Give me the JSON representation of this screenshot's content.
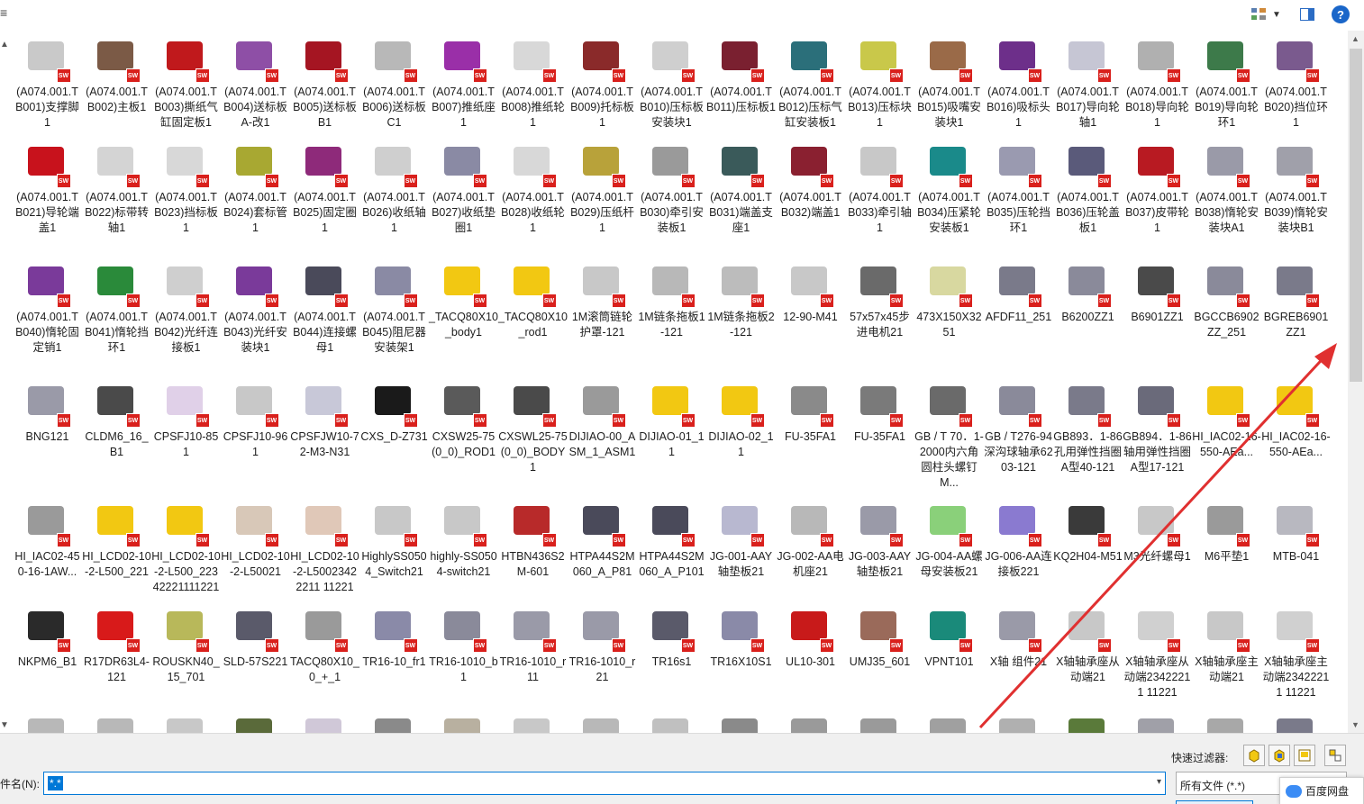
{
  "toolbar": {
    "left_glyph": "≡",
    "view_icon": "view-menu-icon",
    "dropdown_glyph": "▼",
    "preview_icon": "preview-pane-icon",
    "help_label": "?"
  },
  "files": [
    {
      "name": "(A074.001.TB001)支撑脚1",
      "color": "#c9c9c9"
    },
    {
      "name": "(A074.001.TB002)主板1",
      "color": "#7b5a46"
    },
    {
      "name": "(A074.001.TB003)撕纸气缸固定板1",
      "color": "#c0191c"
    },
    {
      "name": "(A074.001.TB004)送标板A-改1",
      "color": "#8e4fa6"
    },
    {
      "name": "(A074.001.TB005)送标板B1",
      "color": "#a51522"
    },
    {
      "name": "(A074.001.TB006)送标板C1",
      "color": "#b8b8b8"
    },
    {
      "name": "(A074.001.TB007)推纸座1",
      "color": "#9a2fa8"
    },
    {
      "name": "(A074.001.TB008)推纸轮1",
      "color": "#d8d8d8"
    },
    {
      "name": "(A074.001.TB009)托标板1",
      "color": "#8a2a2a"
    },
    {
      "name": "(A074.001.TB010)压标板安装块1",
      "color": "#cfcfcf"
    },
    {
      "name": "(A074.001.TB011)压标板1",
      "color": "#7a2030"
    },
    {
      "name": "(A074.001.TB012)压标气缸安装板1",
      "color": "#2b6f7a"
    },
    {
      "name": "(A074.001.TB013)压标块1",
      "color": "#c9c84a"
    },
    {
      "name": "(A074.001.TB015)吸嘴安装块1",
      "color": "#9a6a48"
    },
    {
      "name": "(A074.001.TB016)吸标头1",
      "color": "#6d2f8a"
    },
    {
      "name": "(A074.001.TB017)导向轮轴1",
      "color": "#c6c6d4"
    },
    {
      "name": "(A074.001.TB018)导向轮1",
      "color": "#b0b0b0"
    },
    {
      "name": "(A074.001.TB019)导向轮环1",
      "color": "#3d7a4a"
    },
    {
      "name": "(A074.001.TB020)挡位环1",
      "color": "#7a5a8e"
    },
    {
      "name": "(A074.001.TB021)导轮端盖1",
      "color": "#c8121c"
    },
    {
      "name": "(A074.001.TB022)标带转轴1",
      "color": "#d4d4d4"
    },
    {
      "name": "(A074.001.TB023)挡标板1",
      "color": "#d8d8d8"
    },
    {
      "name": "(A074.001.TB024)套标管1",
      "color": "#a8a832"
    },
    {
      "name": "(A074.001.TB025)固定圈1",
      "color": "#8e2a7a"
    },
    {
      "name": "(A074.001.TB026)收纸轴1",
      "color": "#cfcfcf"
    },
    {
      "name": "(A074.001.TB027)收纸垫圈1",
      "color": "#8a8aa4"
    },
    {
      "name": "(A074.001.TB028)收纸轮1",
      "color": "#d8d8d8"
    },
    {
      "name": "(A074.001.TB029)压纸杆1",
      "color": "#b8a23a"
    },
    {
      "name": "(A074.001.TB030)牵引安装板1",
      "color": "#9a9a9a"
    },
    {
      "name": "(A074.001.TB031)端盖支座1",
      "color": "#3a5a5a"
    },
    {
      "name": "(A074.001.TB032)端盖1",
      "color": "#8a2030"
    },
    {
      "name": "(A074.001.TB033)牵引轴1",
      "color": "#c8c8c8"
    },
    {
      "name": "(A074.001.TB034)压紧轮安装板1",
      "color": "#1a8a8a"
    },
    {
      "name": "(A074.001.TB035)压轮挡环1",
      "color": "#9a9ab0"
    },
    {
      "name": "(A074.001.TB036)压轮盖板1",
      "color": "#5a5a7a"
    },
    {
      "name": "(A074.001.TB037)皮带轮1",
      "color": "#b81a22"
    },
    {
      "name": "(A074.001.TB038)惰轮安装块A1",
      "color": "#9a9aa8"
    },
    {
      "name": "(A074.001.TB039)惰轮安装块B1",
      "color": "#a0a0aa"
    },
    {
      "name": "(A074.001.TB040)惰轮固定销1",
      "color": "#7a3a9a"
    },
    {
      "name": "(A074.001.TB041)惰轮挡环1",
      "color": "#2a8a3a"
    },
    {
      "name": "(A074.001.TB042)光纤连接板1",
      "color": "#cfcfcf"
    },
    {
      "name": "(A074.001.TB043)光纤安装块1",
      "color": "#7a3a9a"
    },
    {
      "name": "(A074.001.TB044)连接螺母1",
      "color": "#4a4a5a"
    },
    {
      "name": "(A074.001.TB045)阻尼器安装架1",
      "color": "#8a8aa4"
    },
    {
      "name": "_TACQ80X10_body1",
      "color": "#f2c812"
    },
    {
      "name": "_TACQ80X10_rod1",
      "color": "#f2c812"
    },
    {
      "name": "1M滚筒链轮护罩-121",
      "color": "#c8c8c8"
    },
    {
      "name": "1M链条拖板1-121",
      "color": "#b8b8b8"
    },
    {
      "name": "1M链条拖板2-121",
      "color": "#bcbcbc"
    },
    {
      "name": "12-90-M41",
      "color": "#c8c8c8"
    },
    {
      "name": "57x57x45步进电机21",
      "color": "#6a6a6a"
    },
    {
      "name": "473X150X3251",
      "color": "#d8d8a0"
    },
    {
      "name": "AFDF11_251",
      "color": "#7a7a8a"
    },
    {
      "name": "B6200ZZ1",
      "color": "#8a8a9a"
    },
    {
      "name": "B6901ZZ1",
      "color": "#4a4a4a"
    },
    {
      "name": "BGCCB6902ZZ_251",
      "color": "#8a8a9a"
    },
    {
      "name": "BGREB6901ZZ1",
      "color": "#7a7a8a"
    },
    {
      "name": "BNG121",
      "color": "#9a9aa8"
    },
    {
      "name": "CLDM6_16_B1",
      "color": "#4a4a4a"
    },
    {
      "name": "CPSFJ10-851",
      "color": "#e0d0e8"
    },
    {
      "name": "CPSFJ10-961",
      "color": "#c8c8c8"
    },
    {
      "name": "CPSFJW10-72-M3-N31",
      "color": "#c8c8d8"
    },
    {
      "name": "CXS_D-Z731",
      "color": "#1a1a1a"
    },
    {
      "name": "CXSW25-75(0_0)_ROD1",
      "color": "#5a5a5a"
    },
    {
      "name": "CXSWL25-75(0_0)_BODY1",
      "color": "#4a4a4a"
    },
    {
      "name": "DIJIAO-00_ASM_1_ASM1",
      "color": "#9a9a9a"
    },
    {
      "name": "DIJIAO-01_11",
      "color": "#f2c812"
    },
    {
      "name": "DIJIAO-02_11",
      "color": "#f2c812"
    },
    {
      "name": "FU-35FA1",
      "color": "#8a8a8a"
    },
    {
      "name": "FU-35FA1",
      "color": "#7a7a7a"
    },
    {
      "name": "GB / T 70．1-2000内六角圆柱头螺钉M...",
      "color": "#6a6a6a"
    },
    {
      "name": "GB / T276-94深沟球轴承6203-121",
      "color": "#8a8a9a"
    },
    {
      "name": "GB893．1-86孔用弹性挡圈A型40-121",
      "color": "#7a7a8a"
    },
    {
      "name": "GB894．1-86轴用弹性挡圈A型17-121",
      "color": "#6a6a7a"
    },
    {
      "name": "HI_IAC02-16-550-AEa...",
      "color": "#f2c812"
    },
    {
      "name": "HI_IAC02-16-550-AEa...",
      "color": "#f2c812"
    },
    {
      "name": "HI_IAC02-450-16-1AW...",
      "color": "#9a9a9a"
    },
    {
      "name": "HI_LCD02-10-2-L500_221",
      "color": "#f2c812"
    },
    {
      "name": "HI_LCD02-10-2-L500_22342221111221",
      "color": "#f2c812"
    },
    {
      "name": "HI_LCD02-10-2-L50021",
      "color": "#d8c8b8"
    },
    {
      "name": "HI_LCD02-10-2-L50023422211 11221",
      "color": "#e0c8b8"
    },
    {
      "name": "HighlySS0504_Switch21",
      "color": "#c8c8c8"
    },
    {
      "name": "highly-SS0504-switch21",
      "color": "#c8c8c8"
    },
    {
      "name": "HTBN436S2M-601",
      "color": "#b82a2a"
    },
    {
      "name": "HTPA44S2M060_A_P81",
      "color": "#4a4a5a"
    },
    {
      "name": "HTPA44S2M060_A_P101",
      "color": "#4a4a5a"
    },
    {
      "name": "JG-001-AAY轴垫板21",
      "color": "#b8b8d0"
    },
    {
      "name": "JG-002-AA电机座21",
      "color": "#b8b8b8"
    },
    {
      "name": "JG-003-AAY轴垫板21",
      "color": "#9a9aa8"
    },
    {
      "name": "JG-004-AA螺母安装板21",
      "color": "#8ad07a"
    },
    {
      "name": "JG-006-AA连接板221",
      "color": "#8a7ad0"
    },
    {
      "name": "KQ2H04-M51",
      "color": "#3a3a3a"
    },
    {
      "name": "M3光纤螺母1",
      "color": "#c8c8c8"
    },
    {
      "name": "M6平垫1",
      "color": "#9a9a9a"
    },
    {
      "name": "MTB-041",
      "color": "#b8b8c0"
    },
    {
      "name": "NKPM6_B1",
      "color": "#2a2a2a"
    },
    {
      "name": "R17DR63L4-121",
      "color": "#d81a1a"
    },
    {
      "name": "ROUSKN40_15_701",
      "color": "#b8b85a"
    },
    {
      "name": "SLD-57S221",
      "color": "#5a5a6a"
    },
    {
      "name": "TACQ80X10_0_+_1",
      "color": "#9a9a9a"
    },
    {
      "name": "TR16-10_fr1",
      "color": "#8a8aa8"
    },
    {
      "name": "TR16-1010_b1",
      "color": "#8a8a9a"
    },
    {
      "name": "TR16-1010_r11",
      "color": "#9a9aa8"
    },
    {
      "name": "TR16-1010_r21",
      "color": "#9a9aa8"
    },
    {
      "name": "TR16s1",
      "color": "#5a5a6a"
    },
    {
      "name": "TR16X10S1",
      "color": "#8a8aa8"
    },
    {
      "name": "UL10-301",
      "color": "#c81a1a"
    },
    {
      "name": "UMJ35_601",
      "color": "#9a6a5a"
    },
    {
      "name": "VPNT101",
      "color": "#1a8a7a"
    },
    {
      "name": "X轴 组件21",
      "color": "#9a9aa8"
    },
    {
      "name": "X轴轴承座从动端21",
      "color": "#c8c8c8"
    },
    {
      "name": "X轴轴承座从动端23422211 11221",
      "color": "#d0d0d0"
    },
    {
      "name": "X轴轴承座主动端21",
      "color": "#c8c8c8"
    },
    {
      "name": "X轴轴承座主动端23422211 11221",
      "color": "#d0d0d0"
    },
    {
      "name": "",
      "color": "#b8b8b8"
    },
    {
      "name": "",
      "color": "#b8b8b8"
    },
    {
      "name": "",
      "color": "#c8c8c8"
    },
    {
      "name": "",
      "color": "#5a6a3a"
    },
    {
      "name": "",
      "color": "#d0c8d8"
    },
    {
      "name": "",
      "color": "#8a8a8a"
    },
    {
      "name": "",
      "color": "#b8b0a0"
    },
    {
      "name": "",
      "color": "#c8c8c8"
    },
    {
      "name": "",
      "color": "#b8b8b8"
    },
    {
      "name": "",
      "color": "#c0c0c0"
    },
    {
      "name": "",
      "color": "#8a8a8a"
    },
    {
      "name": "",
      "color": "#9a9a9a"
    },
    {
      "name": "",
      "color": "#9a9a9a"
    },
    {
      "name": "",
      "color": "#a0a0a0"
    },
    {
      "name": "",
      "color": "#b0b0b0"
    },
    {
      "name": "",
      "color": "#5a7a3a"
    },
    {
      "name": "",
      "color": "#a0a0a8"
    },
    {
      "name": "",
      "color": "#a8a8a8"
    },
    {
      "name": "",
      "color": "#7a7a8a"
    }
  ],
  "sw_badge": "SW",
  "annotation_color": "#e03030",
  "bottom": {
    "quick_filter_label": "快速过滤器:",
    "filter_icons": [
      "part-filter-icon",
      "assembly-filter-icon",
      "drawing-filter-icon",
      "top-level-filter-icon"
    ],
    "filename_label": "件名(N):",
    "filename_value": "*.*",
    "filetype_value": "所有文件 (*.*)",
    "baidu_label": "百度网盘",
    "dropdown_glyph": "▾"
  }
}
